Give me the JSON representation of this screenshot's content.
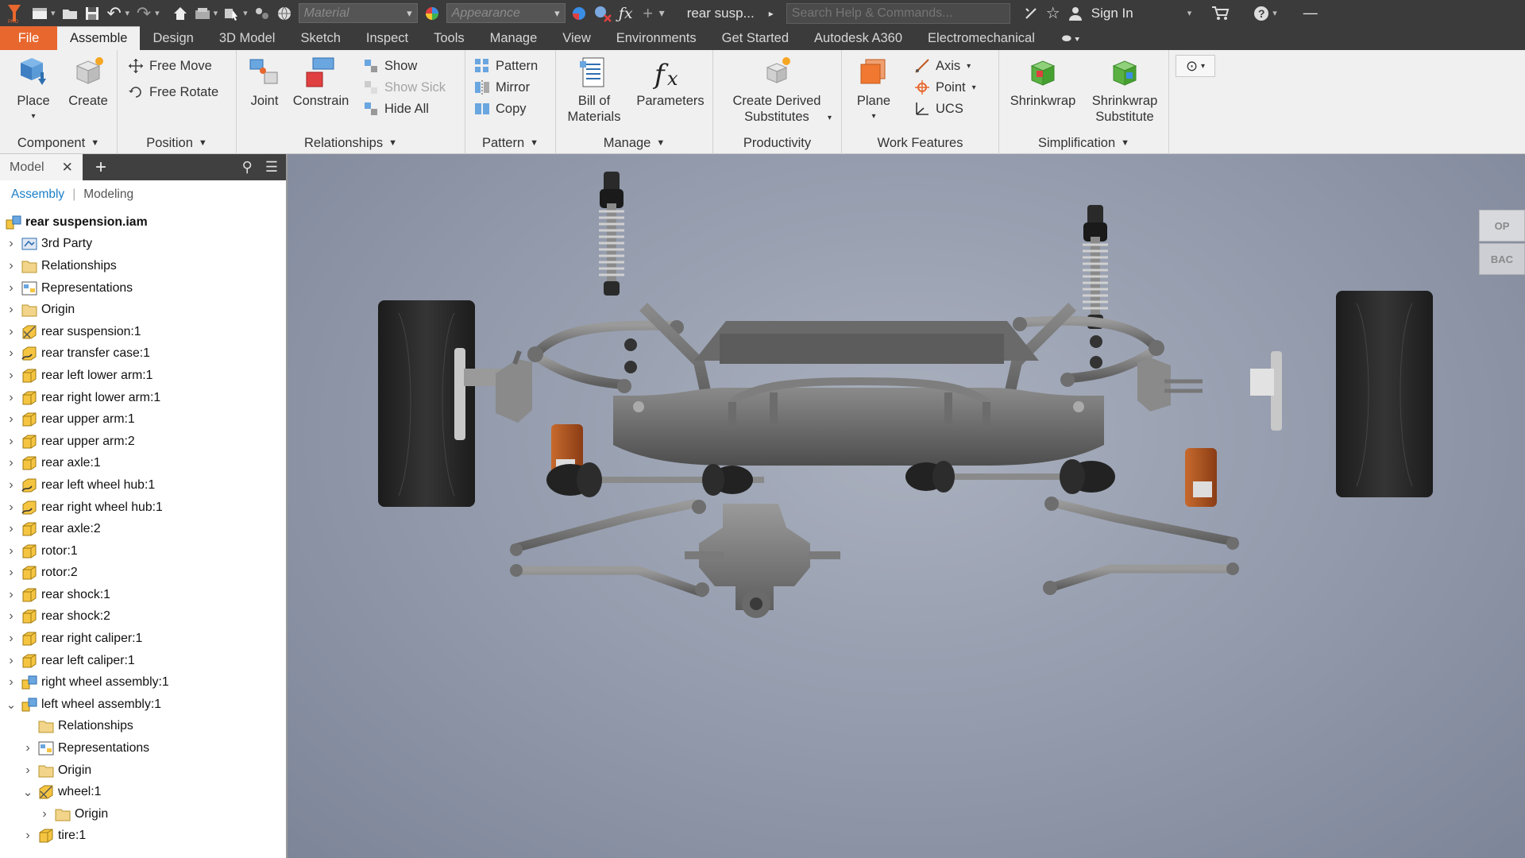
{
  "quick_access": {
    "material_placeholder": "Material",
    "appearance_placeholder": "Appearance",
    "document_title": "rear susp...",
    "help_search_placeholder": "Search Help & Commands...",
    "sign_in": "Sign In"
  },
  "tabs": [
    "File",
    "Assemble",
    "Design",
    "3D Model",
    "Sketch",
    "Inspect",
    "Tools",
    "Manage",
    "View",
    "Environments",
    "Get Started",
    "Autodesk A360",
    "Electromechanical"
  ],
  "active_tab": "Assemble",
  "ribbon": {
    "component": {
      "label": "Component",
      "place": "Place",
      "create": "Create"
    },
    "position": {
      "label": "Position",
      "free_move": "Free Move",
      "free_rotate": "Free Rotate"
    },
    "relationships": {
      "label": "Relationships",
      "joint": "Joint",
      "constrain": "Constrain",
      "show": "Show",
      "show_sick": "Show Sick",
      "hide_all": "Hide All"
    },
    "pattern": {
      "label": "Pattern",
      "pattern": "Pattern",
      "mirror": "Mirror",
      "copy": "Copy"
    },
    "manage": {
      "label": "Manage",
      "bom_line1": "Bill of",
      "bom_line2": "Materials",
      "parameters": "Parameters"
    },
    "productivity": {
      "label": "Productivity",
      "cds_line1": "Create Derived",
      "cds_line2": "Substitutes"
    },
    "work_features": {
      "label": "Work Features",
      "plane": "Plane",
      "axis": "Axis",
      "point": "Point",
      "ucs": "UCS"
    },
    "simplification": {
      "label": "Simplification",
      "shrinkwrap": "Shrinkwrap",
      "sws_line1": "Shrinkwrap",
      "sws_line2": "Substitute"
    }
  },
  "browser": {
    "tab_label": "Model",
    "view_assembly": "Assembly",
    "view_modeling": "Modeling",
    "tree": [
      {
        "label": "rear suspension.iam",
        "icon": "assembly-icon",
        "level": 0,
        "arrow": "",
        "root": true
      },
      {
        "label": "3rd Party",
        "icon": "third-party-icon",
        "level": 0,
        "arrow": "right"
      },
      {
        "label": "Relationships",
        "icon": "folder-icon",
        "level": 0,
        "arrow": "right"
      },
      {
        "label": "Representations",
        "icon": "representations-icon",
        "level": 0,
        "arrow": "right"
      },
      {
        "label": "Origin",
        "icon": "folder-icon",
        "level": 0,
        "arrow": "right"
      },
      {
        "label": "rear suspension:1",
        "icon": "derived-part-icon",
        "level": 0,
        "arrow": "right"
      },
      {
        "label": "rear transfer case:1",
        "icon": "flexible-part-icon",
        "level": 0,
        "arrow": "right"
      },
      {
        "label": "rear left lower arm:1",
        "icon": "part-icon",
        "level": 0,
        "arrow": "right"
      },
      {
        "label": "rear right lower arm:1",
        "icon": "part-icon",
        "level": 0,
        "arrow": "right"
      },
      {
        "label": "rear upper arm:1",
        "icon": "part-icon",
        "level": 0,
        "arrow": "right"
      },
      {
        "label": "rear upper arm:2",
        "icon": "part-icon",
        "level": 0,
        "arrow": "right"
      },
      {
        "label": "rear axle:1",
        "icon": "part-icon",
        "level": 0,
        "arrow": "right"
      },
      {
        "label": "rear left wheel hub:1",
        "icon": "flexible-part-icon",
        "level": 0,
        "arrow": "right"
      },
      {
        "label": "rear right wheel hub:1",
        "icon": "flexible-part-icon",
        "level": 0,
        "arrow": "right"
      },
      {
        "label": "rear axle:2",
        "icon": "part-icon",
        "level": 0,
        "arrow": "right"
      },
      {
        "label": "rotor:1",
        "icon": "part-icon",
        "level": 0,
        "arrow": "right"
      },
      {
        "label": "rotor:2",
        "icon": "part-icon",
        "level": 0,
        "arrow": "right"
      },
      {
        "label": "rear shock:1",
        "icon": "part-icon",
        "level": 0,
        "arrow": "right"
      },
      {
        "label": "rear shock:2",
        "icon": "part-icon",
        "level": 0,
        "arrow": "right"
      },
      {
        "label": "rear right caliper:1",
        "icon": "part-icon",
        "level": 0,
        "arrow": "right"
      },
      {
        "label": "rear left caliper:1",
        "icon": "part-icon",
        "level": 0,
        "arrow": "right"
      },
      {
        "label": "right wheel assembly:1",
        "icon": "assembly-icon",
        "level": 0,
        "arrow": "right"
      },
      {
        "label": "left wheel assembly:1",
        "icon": "assembly-icon",
        "level": 0,
        "arrow": "down"
      },
      {
        "label": "Relationships",
        "icon": "folder-icon",
        "level": 1,
        "arrow": ""
      },
      {
        "label": "Representations",
        "icon": "representations-icon",
        "level": 1,
        "arrow": "right"
      },
      {
        "label": "Origin",
        "icon": "folder-icon",
        "level": 1,
        "arrow": "right"
      },
      {
        "label": "wheel:1",
        "icon": "derived-part-icon",
        "level": 1,
        "arrow": "down"
      },
      {
        "label": "Origin",
        "icon": "folder-icon",
        "level": 2,
        "arrow": "right"
      },
      {
        "label": "tire:1",
        "icon": "part-icon",
        "level": 1,
        "arrow": "right"
      }
    ]
  },
  "viewcube": {
    "top": "OP",
    "back": "BAC"
  },
  "colors": {
    "file_tab": "#e8672e",
    "titlebar": "#3b3b3b",
    "ribbon": "#f0f0f0",
    "link_blue": "#1b7fc7",
    "part_yellow": "#f5c542",
    "caliper_orange": "#b4561f",
    "tire_black": "#262626",
    "metal_gray": "#7e7e7e"
  }
}
